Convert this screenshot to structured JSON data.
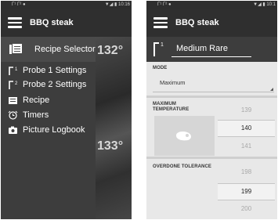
{
  "left_screen": {
    "status_bar": {
      "left": "Γ¹ Γ² ●",
      "right": "▼◢ ▮ 10:16"
    },
    "app_bar": {
      "title": "BBQ steak"
    },
    "drawer": {
      "header": {
        "label": "Recipe Selector",
        "icon": "recipe-book-icon"
      },
      "items": [
        {
          "label": "Probe 1 Settings",
          "icon": "probe-1-icon"
        },
        {
          "label": "Probe 2 Settings",
          "icon": "probe-2-icon"
        },
        {
          "label": "Recipe",
          "icon": "recipe-card-icon"
        },
        {
          "label": "Timers",
          "icon": "alarm-clock-icon"
        },
        {
          "label": "Picture Logbook",
          "icon": "camera-icon"
        }
      ]
    },
    "background_temps": [
      "132°",
      "133°"
    ]
  },
  "right_screen": {
    "status_bar": {
      "left": "Γ¹ Γ² ●",
      "right": "▼◢ ▮ 10:1"
    },
    "app_bar": {
      "title": "BBQ steak"
    },
    "probe": {
      "number": "1",
      "name": "Medium Rare"
    },
    "mode": {
      "label": "MODE",
      "value": "Maximum"
    },
    "max_temp": {
      "label_line1": "MAXIMUM",
      "label_line2": "TEMPERATURE",
      "options": [
        "139",
        "140",
        "141"
      ],
      "selected": "140",
      "icon": "steak-icon"
    },
    "overdone": {
      "label": "OVERDONE TOLERANCE",
      "options": [
        "198",
        "199",
        "200"
      ],
      "selected": "199"
    }
  },
  "colors": {
    "app_bar": "#2f2f2f",
    "drawer": "#3d3d3d",
    "panel_bg": "#e8e8e8",
    "text_light": "#ffffff"
  }
}
